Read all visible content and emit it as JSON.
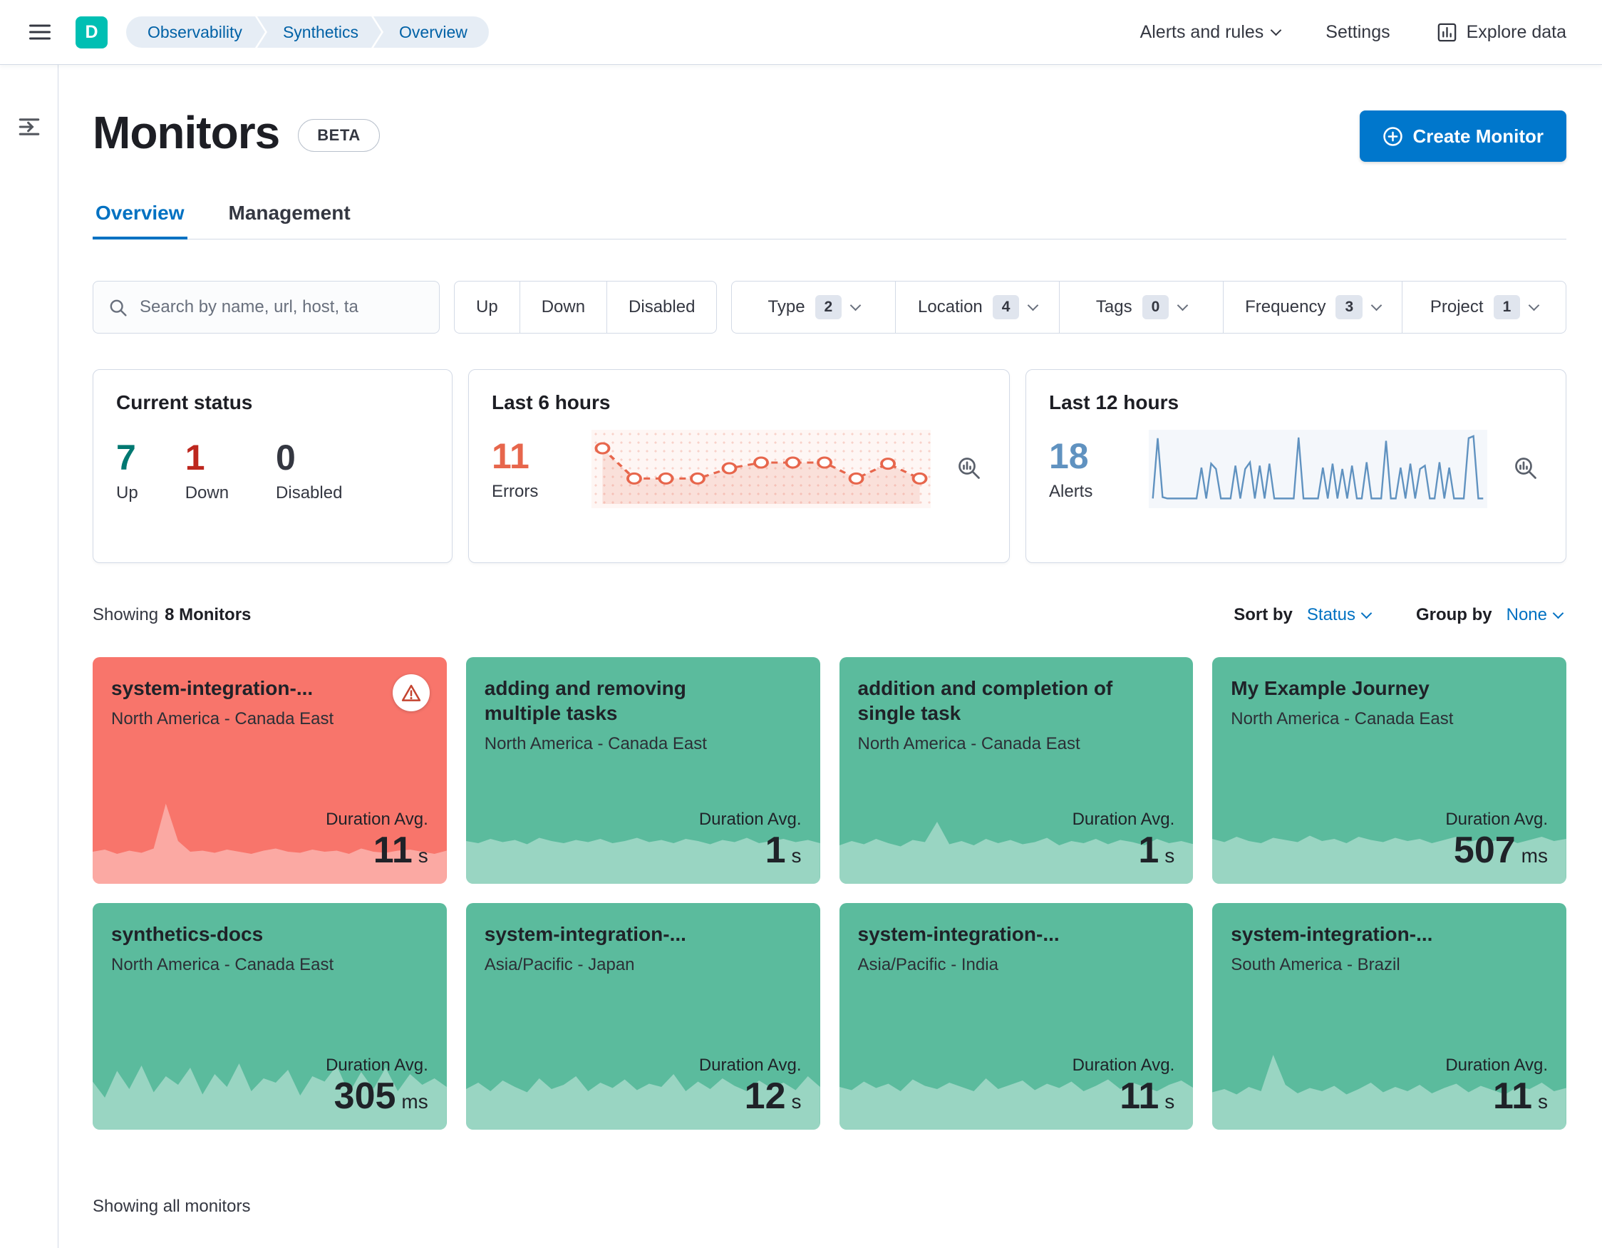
{
  "colors": {
    "primary": "#0077CC",
    "link": "#0071C2",
    "teal_avatar": "#00BFB3",
    "card_up": "#5BBB9D",
    "card_down": "#F8756B",
    "border": "#D3DAE6"
  },
  "icons": [
    "hamburger-menu-icon",
    "expand-menu-icon",
    "chevron-down-icon",
    "bar-chart-icon",
    "search-icon",
    "inspect-chart-icon",
    "warning-triangle-icon",
    "plus-in-circle-icon"
  ],
  "topbar": {
    "space_initial": "D",
    "breadcrumbs": [
      "Observability",
      "Synthetics",
      "Overview"
    ],
    "alerts_menu": "Alerts and rules",
    "settings": "Settings",
    "explore": "Explore data"
  },
  "page": {
    "title": "Monitors",
    "beta_badge": "BETA",
    "create_button": "Create Monitor",
    "tabs": [
      {
        "label": "Overview",
        "active": true
      },
      {
        "label": "Management",
        "active": false
      }
    ],
    "showing_prefix": "Showing",
    "showing_count": "8 Monitors",
    "sort_by_label": "Sort by",
    "sort_by_value": "Status",
    "group_by_label": "Group by",
    "group_by_value": "None",
    "footer_note": "Showing all monitors"
  },
  "filters": {
    "search_placeholder": "Search by name, url, host, ta",
    "status_buttons": [
      "Up",
      "Down",
      "Disabled"
    ],
    "dropdowns": [
      {
        "label": "Type",
        "count": "2"
      },
      {
        "label": "Location",
        "count": "4"
      },
      {
        "label": "Tags",
        "count": "0"
      },
      {
        "label": "Frequency",
        "count": "3"
      },
      {
        "label": "Project",
        "count": "1"
      }
    ]
  },
  "stats": {
    "current_status": {
      "title": "Current status",
      "items": [
        {
          "value": "7",
          "label": "Up",
          "color": "#007871"
        },
        {
          "value": "1",
          "label": "Down",
          "color": "#BD271E"
        },
        {
          "value": "0",
          "label": "Disabled",
          "color": "#343741"
        }
      ]
    },
    "last6": {
      "title": "Last 6 hours",
      "value": "11",
      "label": "Errors",
      "color": "#E7664C",
      "series": [
        85,
        32,
        32,
        32,
        50,
        60,
        60,
        60,
        32,
        58,
        32
      ]
    },
    "last12": {
      "title": "Last 12 hours",
      "value": "18",
      "label": "Alerts",
      "color": "#6092C0",
      "series": [
        6,
        96,
        8,
        6,
        6,
        6,
        6,
        6,
        6,
        6,
        52,
        6,
        58,
        50,
        6,
        6,
        6,
        55,
        6,
        50,
        60,
        6,
        55,
        6,
        58,
        6,
        6,
        6,
        6,
        6,
        97,
        6,
        6,
        6,
        6,
        52,
        6,
        58,
        6,
        50,
        6,
        55,
        6,
        6,
        60,
        6,
        6,
        6,
        92,
        6,
        6,
        52,
        6,
        58,
        6,
        50,
        55,
        6,
        6,
        60,
        6,
        52,
        6,
        6,
        6,
        96,
        99,
        6,
        6
      ]
    }
  },
  "monitors": [
    {
      "name": "system-integration-...",
      "location": "North America - Canada East",
      "status": "down",
      "duration_label": "Duration Avg.",
      "duration_value": "11",
      "duration_unit": "s",
      "spark": [
        30,
        32,
        28,
        31,
        29,
        33,
        75,
        40,
        30,
        31,
        29,
        32,
        30,
        28,
        31,
        33,
        30,
        29,
        32,
        30,
        31,
        28,
        33,
        30,
        29,
        31,
        32,
        30,
        28,
        31
      ]
    },
    {
      "name": "adding and removing multiple tasks",
      "location": "North America - Canada East",
      "status": "up",
      "duration_label": "Duration Avg.",
      "duration_value": "1",
      "duration_unit": "s",
      "spark": [
        40,
        38,
        42,
        39,
        41,
        37,
        43,
        40,
        38,
        41,
        39,
        42,
        38,
        40,
        43,
        39,
        41,
        38,
        42,
        40,
        37,
        41,
        39,
        43,
        38,
        40,
        42,
        39,
        41,
        38
      ]
    },
    {
      "name": "addition and completion of single task",
      "location": "North America - Canada East",
      "status": "up",
      "duration_label": "Duration Avg.",
      "duration_value": "1",
      "duration_unit": "s",
      "spark": [
        36,
        40,
        37,
        42,
        38,
        35,
        41,
        39,
        58,
        37,
        40,
        36,
        42,
        38,
        41,
        37,
        39,
        43,
        36,
        40,
        38,
        42,
        37,
        41,
        39,
        36,
        42,
        38,
        40,
        37
      ]
    },
    {
      "name": "My Example Journey",
      "location": "North America - Canada East",
      "status": "up",
      "duration_label": "Duration Avg.",
      "duration_value": "507",
      "duration_unit": "ms",
      "spark": [
        42,
        39,
        44,
        40,
        38,
        43,
        41,
        39,
        45,
        40,
        42,
        38,
        44,
        41,
        39,
        43,
        40,
        42,
        38,
        41,
        44,
        39,
        42,
        40,
        43,
        38,
        41,
        44,
        40,
        42
      ]
    },
    {
      "name": "synthetics-docs",
      "location": "North America - Canada East",
      "status": "up",
      "duration_label": "Duration Avg.",
      "duration_value": "305",
      "duration_unit": "ms",
      "spark": [
        45,
        30,
        55,
        38,
        60,
        35,
        50,
        42,
        58,
        33,
        52,
        40,
        62,
        36,
        48,
        44,
        56,
        32,
        50,
        45,
        60,
        34,
        54,
        38,
        58,
        36,
        52,
        42,
        48,
        40
      ]
    },
    {
      "name": "system-integration-...",
      "location": "Asia/Pacific - Japan",
      "status": "up",
      "duration_label": "Duration Avg.",
      "duration_value": "12",
      "duration_unit": "s",
      "spark": [
        38,
        44,
        36,
        46,
        40,
        35,
        48,
        38,
        42,
        50,
        36,
        44,
        39,
        47,
        37,
        43,
        40,
        52,
        36,
        45,
        38,
        48,
        41,
        36,
        46,
        39,
        44,
        37,
        50,
        40
      ]
    },
    {
      "name": "system-integration-...",
      "location": "Asia/Pacific - India",
      "status": "up",
      "duration_label": "Duration Avg.",
      "duration_value": "11",
      "duration_unit": "s",
      "spark": [
        40,
        37,
        45,
        39,
        43,
        36,
        47,
        41,
        38,
        44,
        40,
        36,
        48,
        38,
        42,
        46,
        37,
        43,
        39,
        45,
        36,
        41,
        47,
        38,
        44,
        40,
        36,
        42,
        46,
        39
      ]
    },
    {
      "name": "system-integration-...",
      "location": "South America - Brazil",
      "status": "up",
      "duration_label": "Duration Avg.",
      "duration_value": "11",
      "duration_unit": "s",
      "spark": [
        35,
        38,
        33,
        40,
        36,
        70,
        42,
        34,
        39,
        36,
        41,
        33,
        38,
        44,
        35,
        40,
        36,
        42,
        34,
        39,
        43,
        35,
        41,
        37,
        33,
        40,
        38,
        44,
        36,
        39
      ]
    }
  ]
}
